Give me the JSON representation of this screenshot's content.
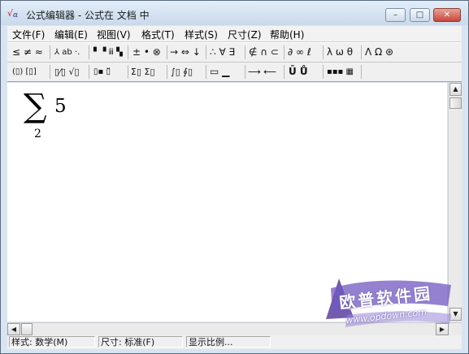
{
  "window": {
    "title": "公式编辑器 - 公式在 文档 中",
    "app_icon": {
      "name": "equation-editor-icon",
      "glyph_rad": "√",
      "glyph_alpha": "α"
    },
    "controls": {
      "minimize": "–",
      "maximize": "□",
      "close": "✕"
    }
  },
  "menu": [
    {
      "label": "文件(F)"
    },
    {
      "label": "编辑(E)"
    },
    {
      "label": "视图(V)"
    },
    {
      "label": "格式(T)"
    },
    {
      "label": "样式(S)"
    },
    {
      "label": "尺寸(Z)"
    },
    {
      "label": "帮助(H)"
    }
  ],
  "toolbar_row1": [
    {
      "label": "≤ ≠ ≈",
      "name": "relational-symbols-palette"
    },
    {
      "label": "⅄ ab ·.",
      "name": "spaces-ellipses-palette"
    },
    {
      "label": "▘▝ ⅲ ▚",
      "name": "embellishments-palette"
    },
    {
      "label": "± • ⊗",
      "name": "operator-symbols-palette"
    },
    {
      "label": "→ ⇔ ↓",
      "name": "arrow-symbols-palette"
    },
    {
      "label": "∴ ∀ ∃",
      "name": "logical-symbols-palette"
    },
    {
      "label": "∉ ∩ ⊂",
      "name": "set-theory-symbols-palette"
    },
    {
      "label": "∂ ∞ ℓ",
      "name": "miscellaneous-symbols-palette"
    },
    {
      "label": "λ ω θ",
      "name": "greek-lowercase-palette"
    },
    {
      "label": "Λ Ω ⊛",
      "name": "greek-uppercase-palette"
    }
  ],
  "toolbar_row2": [
    {
      "label": "(▯) [▯]",
      "name": "fence-templates-palette"
    },
    {
      "label": "▯⁄▯ √▯",
      "name": "fraction-radical-templates-palette"
    },
    {
      "label": "▯▪ ▯̈",
      "name": "subscript-superscript-templates-palette"
    },
    {
      "label": "Σ▯ Σ▯",
      "name": "summation-templates-palette"
    },
    {
      "label": "∫▯ ∮▯",
      "name": "integral-templates-palette"
    },
    {
      "label": "▭ ▁",
      "name": "underbar-overbar-templates-palette"
    },
    {
      "label": "⟶ ⟵",
      "name": "labeled-arrow-templates-palette"
    },
    {
      "label": "Ū Ů",
      "name": "products-set-theory-templates-palette"
    },
    {
      "label": "▪▪▪ ▦",
      "name": "matrix-templates-palette"
    }
  ],
  "formula": {
    "operator": "∑",
    "lower_limit": "2",
    "body": "5"
  },
  "status": {
    "style": "样式: 数学(M)",
    "size": "尺寸: 标准(F)",
    "zoom": "显示比例..."
  },
  "watermark": {
    "text": "欧普软件园",
    "url": "www.opdown.com"
  },
  "scroll": {
    "up": "▲",
    "down": "▼",
    "left": "◀",
    "right": "▶"
  }
}
